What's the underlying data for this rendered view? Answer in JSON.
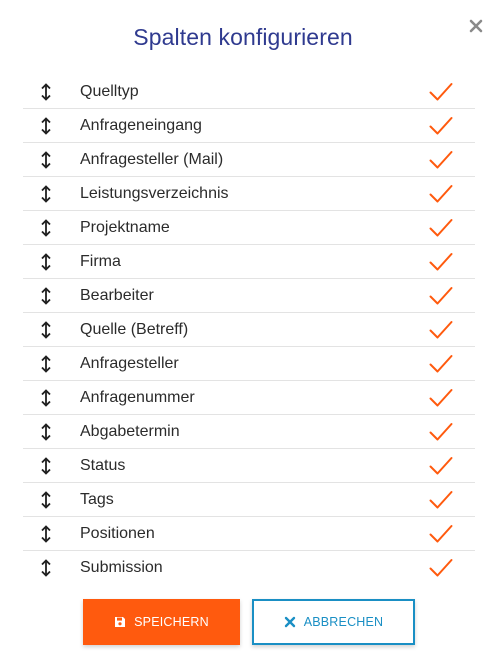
{
  "dialog": {
    "title": "Spalten konfigurieren",
    "close_icon": "close-icon"
  },
  "columns": [
    {
      "label": "Quelltyp",
      "checked": true
    },
    {
      "label": "Anfrageneingang",
      "checked": true
    },
    {
      "label": "Anfragesteller (Mail)",
      "checked": true
    },
    {
      "label": "Leistungsverzeichnis",
      "checked": true
    },
    {
      "label": "Projektname",
      "checked": true
    },
    {
      "label": "Firma",
      "checked": true
    },
    {
      "label": "Bearbeiter",
      "checked": true
    },
    {
      "label": "Quelle (Betreff)",
      "checked": true
    },
    {
      "label": "Anfragesteller",
      "checked": true
    },
    {
      "label": "Anfragenummer",
      "checked": true
    },
    {
      "label": "Abgabetermin",
      "checked": true
    },
    {
      "label": "Status",
      "checked": true
    },
    {
      "label": "Tags",
      "checked": true
    },
    {
      "label": "Positionen",
      "checked": true
    },
    {
      "label": "Submission",
      "checked": true
    }
  ],
  "buttons": {
    "save_label": "SPEICHERN",
    "save_icon": "floppy-disk-icon",
    "cancel_label": "ABBRECHEN",
    "cancel_icon": "x-icon"
  },
  "colors": {
    "title": "#2f3a8f",
    "check": "#ff5a0e",
    "save_bg": "#ff5a0e",
    "cancel_accent": "#1a8fc4",
    "close": "#8a8a8a"
  }
}
